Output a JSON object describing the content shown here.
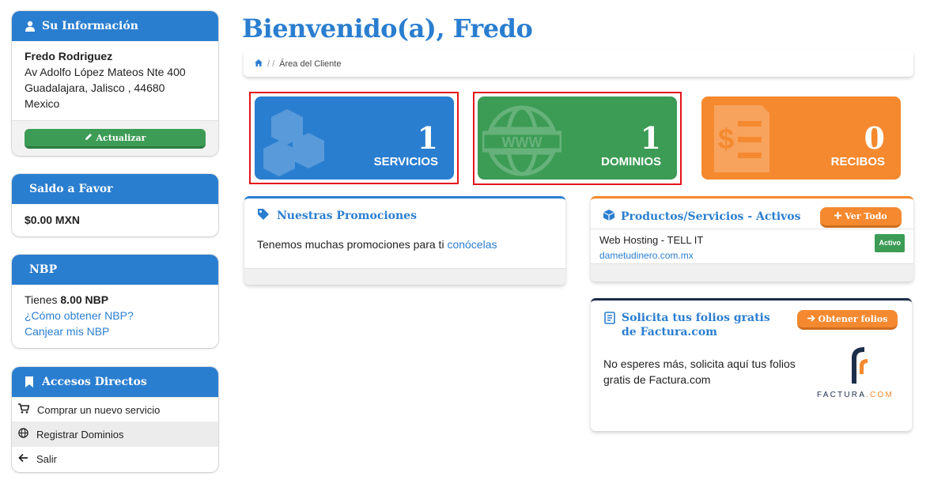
{
  "user_panel": {
    "title": "Su Información",
    "name": "Fredo Rodriguez",
    "address1": "Av Adolfo López Mateos Nte 400",
    "address2": "Guadalajara, Jalisco , 44680",
    "country": "Mexico",
    "update_label": "Actualizar"
  },
  "balance_panel": {
    "title": "Saldo a Favor",
    "amount": "$0.00 MXN"
  },
  "nbp_panel": {
    "title": "NBP",
    "prefix": "Tienes ",
    "amount": "8.00 NBP",
    "link_how": "¿Cómo obtener NBP?",
    "link_redeem": "Canjear mis NBP"
  },
  "shortcuts_panel": {
    "title": "Accesos Directos",
    "items": [
      {
        "label": "Comprar un nuevo servicio",
        "icon": "cart-icon"
      },
      {
        "label": "Registrar Dominios",
        "icon": "globe-icon"
      },
      {
        "label": "Salir",
        "icon": "arrow-left-icon"
      }
    ]
  },
  "header": {
    "title": "Bienvenido(a), Fredo",
    "breadcrumb_sep": "/ /",
    "breadcrumb_current": "Área del Cliente"
  },
  "tiles": [
    {
      "count": "1",
      "label": "SERVICIOS",
      "color": "#2a7ed0"
    },
    {
      "count": "1",
      "label": "DOMINIOS",
      "color": "#3c9c55"
    },
    {
      "count": "0",
      "label": "RECIBOS",
      "color": "#f5892f"
    }
  ],
  "promotions": {
    "title": "Nuestras Promociones",
    "text": "Tenemos muchas promociones para ti ",
    "link": "conócelas"
  },
  "products": {
    "title": "Productos/Servicios - Activos",
    "button": "Ver Todo",
    "item_name": "Web Hosting - TELL IT",
    "item_domain": "dametudinero.com.mx",
    "item_status": "Activo"
  },
  "folios": {
    "title": "Solicita tus folios gratis de Factura.com",
    "button": "Obtener folios",
    "text": "No esperes más, solicita aquí tus folios gratis de Factura.com",
    "logo_text": "FACTURA",
    "logo_suffix": ".COM"
  },
  "colors": {
    "primary": "#2a7ed0",
    "green": "#3c9c55",
    "orange": "#f5892f",
    "highlight": "#e4151b"
  }
}
